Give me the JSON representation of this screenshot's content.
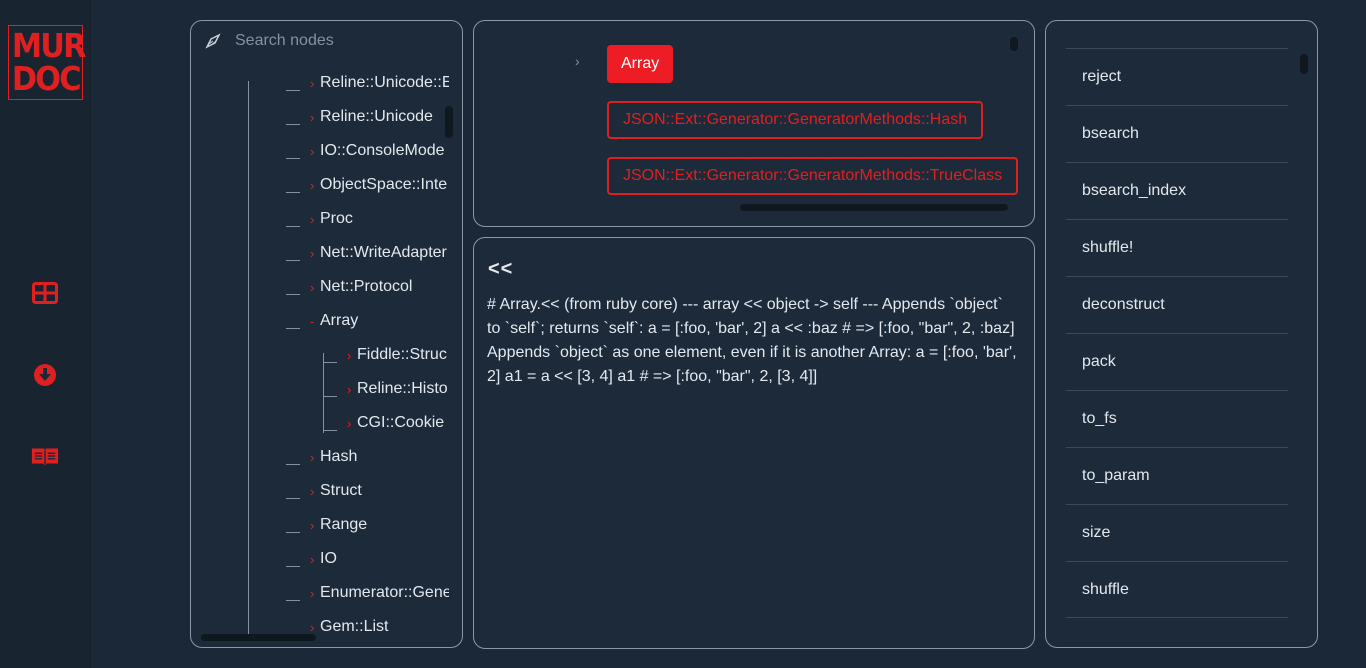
{
  "logo": {
    "line1": "MUR",
    "line2": "DOC"
  },
  "rail": {
    "icons": [
      "layout-grid-icon",
      "download-circle-icon",
      "open-book-icon"
    ]
  },
  "colors": {
    "accent": "#e02020",
    "background": "#1b2838",
    "panel_border": "#8c98a6"
  },
  "search": {
    "placeholder": "Search nodes"
  },
  "tree": {
    "nodes": [
      {
        "label": "Reline::Unicode::E",
        "expanded": false
      },
      {
        "label": "Reline::Unicode",
        "expanded": false
      },
      {
        "label": "IO::ConsoleMode",
        "expanded": false
      },
      {
        "label": "ObjectSpace::Inte",
        "expanded": false
      },
      {
        "label": "Proc",
        "expanded": false
      },
      {
        "label": "Net::WriteAdapter",
        "expanded": false
      },
      {
        "label": "Net::Protocol",
        "expanded": false
      },
      {
        "label": "Array",
        "expanded": true
      },
      {
        "label": "Fiddle::Struc",
        "expanded": false
      },
      {
        "label": "Reline::Histo",
        "expanded": false
      },
      {
        "label": "CGI::Cookie",
        "expanded": false
      },
      {
        "label": "Hash",
        "expanded": false
      },
      {
        "label": "Struct",
        "expanded": false
      },
      {
        "label": "Range",
        "expanded": false
      },
      {
        "label": "IO",
        "expanded": false
      },
      {
        "label": "Enumerator::Gene",
        "expanded": false
      },
      {
        "label": "Gem::List",
        "expanded": false
      }
    ]
  },
  "inspect": {
    "selected": "Array",
    "related": [
      "JSON::Ext::Generator::GeneratorMethods::Hash",
      "JSON::Ext::Generator::GeneratorMethods::TrueClass"
    ]
  },
  "doc": {
    "title": "<<",
    "body": "# Array.<< (from ruby core) --- array << object -> self --- Appends `object` to `self`; returns `self`: a = [:foo, 'bar', 2] a << :baz # => [:foo, \"bar\", 2, :baz] Appends `object` as one element, even if it is another Array: a = [:foo, 'bar', 2] a1 = a << [3, 4] a1 # => [:foo, \"bar\", 2, [3, 4]]"
  },
  "methods": {
    "items": [
      "reject",
      "bsearch",
      "bsearch_index",
      "shuffle!",
      "deconstruct",
      "pack",
      "to_fs",
      "to_param",
      "size",
      "shuffle"
    ]
  }
}
